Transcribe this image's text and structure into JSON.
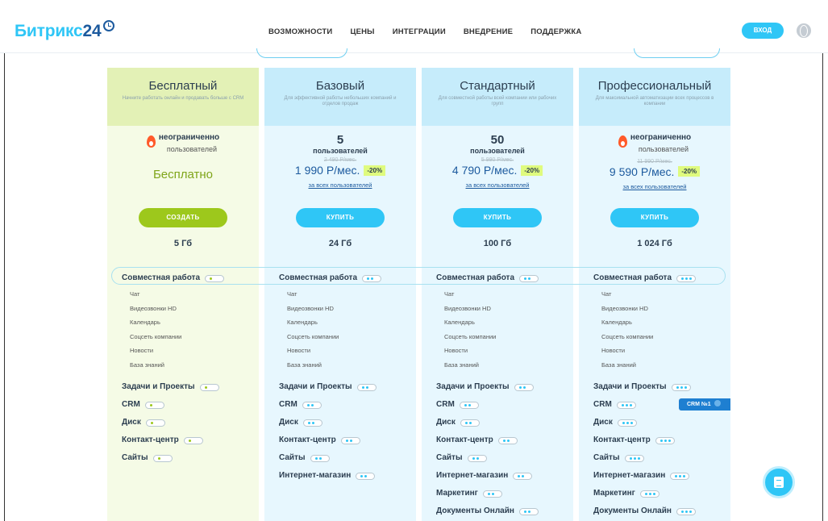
{
  "header": {
    "logo_main": "Битрикс",
    "logo_num": "24",
    "nav": [
      "ВОЗМОЖНОСТИ",
      "ЦЕНЫ",
      "ИНТЕГРАЦИИ",
      "ВНЕДРЕНИЕ",
      "ПОДДЕРЖКА"
    ],
    "login": "ВХОД"
  },
  "plans": [
    {
      "name": "Бесплатный",
      "desc": "Начните работать онлайн и продавать больше с CRM",
      "users_count": "неограниченно",
      "users_label": "пользователей",
      "price_label": "Бесплатно",
      "button": "СОЗДАТЬ",
      "storage": "5 Гб"
    },
    {
      "name": "Базовый",
      "desc": "Для эффективной работы небольших компаний и отделов продаж",
      "users_count": "5",
      "users_label": "пользователей",
      "old_price": "2 490 Р/мес.",
      "price": "1 990 Р/мес.",
      "discount": "-20%",
      "all_users": "за всех пользователей",
      "button": "КУПИТЬ",
      "storage": "24 Гб"
    },
    {
      "name": "Стандартный",
      "desc": "Для совместной работы всей компании или рабочих групп",
      "users_count": "50",
      "users_label": "пользователей",
      "old_price": "5 990 Р/мес.",
      "price": "4 790 Р/мес.",
      "discount": "-20%",
      "all_users": "за всех пользователей",
      "button": "КУПИТЬ",
      "storage": "100 Гб"
    },
    {
      "name": "Профессиональный",
      "desc": "Для максимальной автоматизации всех процессов в компании",
      "users_count": "неограниченно",
      "users_label": "пользователей",
      "old_price": "11 990 Р/мес.",
      "price": "9 590 Р/мес.",
      "discount": "-20%",
      "all_users": "за всех пользователей",
      "button": "КУПИТЬ",
      "storage": "1 024 Гб"
    }
  ],
  "features": {
    "collab": "Совместная работа",
    "collab_items": [
      "Чат",
      "Видеозвонки HD",
      "Календарь",
      "Соцсеть компании",
      "Новости",
      "База знаний"
    ],
    "tasks": "Задачи и Проекты",
    "crm": "CRM",
    "disk": "Диск",
    "contact": "Контакт-центр",
    "sites": "Сайты",
    "shop": "Интернет-магазин",
    "marketing": "Маркетинг",
    "docs": "Документы Онлайн"
  },
  "crm_badge": "CRM №1",
  "colors": {
    "accent_blue": "#2fc6f6",
    "accent_green": "#9dc81c",
    "brand_dark": "#1c5a9e"
  }
}
